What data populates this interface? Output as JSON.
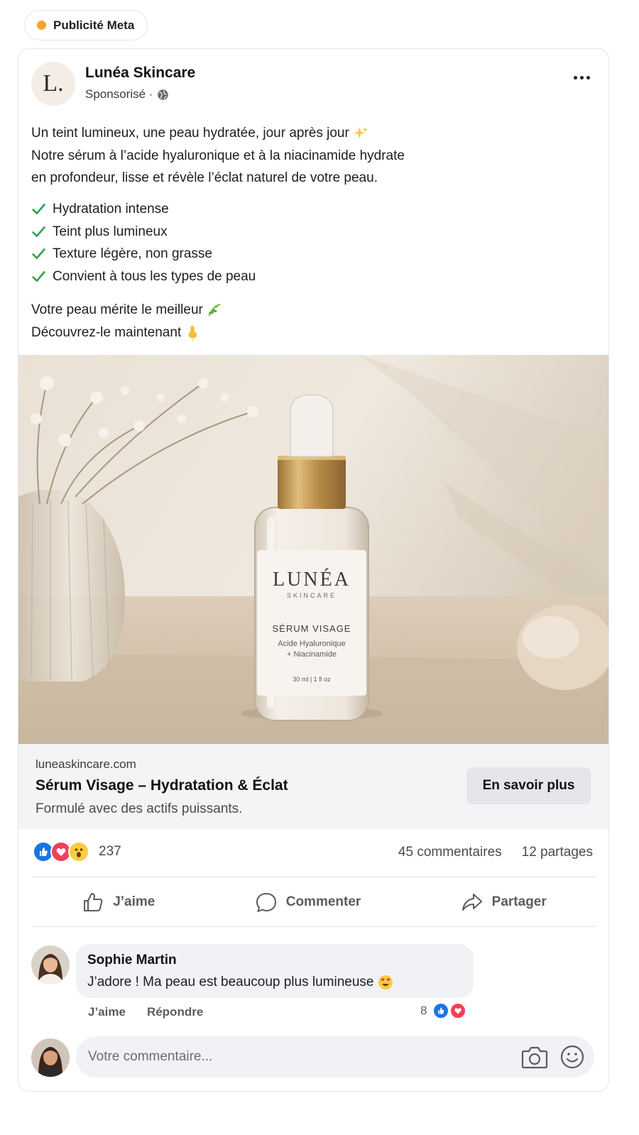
{
  "ad_label": "Publicité Meta",
  "colors": {
    "ad_dot": "#f5a52f",
    "check": "#31a24c",
    "like": "#1b74e4",
    "love": "#f33e58",
    "wow": "#fbcb40"
  },
  "post": {
    "page_name": "Lunéa Skincare",
    "logo_text": "L.",
    "sponsored": "Sponsorisé ·",
    "body_lines": [
      "Un teint lumineux, une peau hydratée, jour après jour",
      "Notre sérum à l’acide hyaluronique et à la niacinamide hydrate",
      "en profondeur, lisse et révèle l’éclat naturel de votre peau."
    ],
    "checklist": [
      "Hydratation intense",
      "Teint plus lumineux",
      "Texture légère, non grasse",
      "Convient à tous les types de peau"
    ],
    "cta_lines": [
      "Votre peau mérite le meilleur",
      "Découvrez-le maintenant"
    ]
  },
  "product": {
    "brand": "LUNÉA",
    "brand_sub": "SKINCARE",
    "name": "SÉRUM VISAGE",
    "ingredient_1": "Acide Hyaluronique",
    "ingredient_2": "+ Niacinamide",
    "volume": "30 ml | 1 fl oz"
  },
  "link": {
    "domain": "luneaskincare.com",
    "title": "Sérum Visage – Hydratation & Éclat",
    "description": "Formulé avec des actifs puissants.",
    "button": "En savoir plus"
  },
  "stats": {
    "reactions": "237",
    "comments": "45 commentaires",
    "shares": "12 partages"
  },
  "actions": {
    "like": "J’aime",
    "comment": "Commenter",
    "share": "Partager"
  },
  "comment": {
    "author": "Sophie Martin",
    "text": "J’adore ! Ma peau est beaucoup plus lumineuse",
    "like": "J’aime",
    "reply": "Répondre",
    "reaction_count": "8"
  },
  "composer": {
    "placeholder": "Votre commentaire..."
  },
  "icons": [
    "globe-icon",
    "more-icon",
    "check-icon",
    "sparkles-icon",
    "leaf-icon",
    "point-down-icon",
    "like-icon",
    "love-icon",
    "wow-icon",
    "comment-icon",
    "share-icon",
    "camera-icon",
    "smiley-icon",
    "heart-eyes-icon"
  ]
}
